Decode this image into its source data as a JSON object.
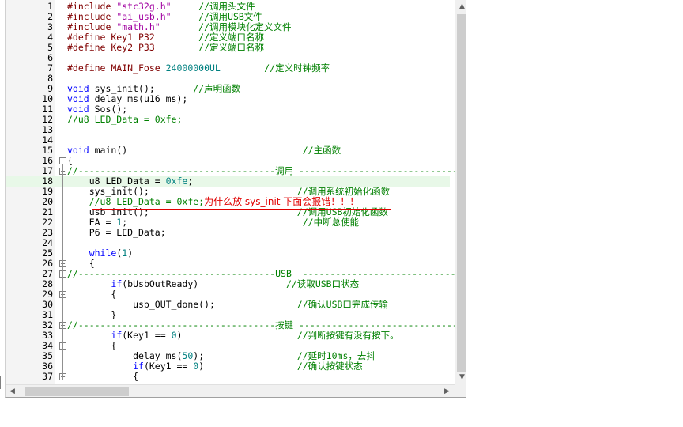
{
  "editor": {
    "lines": [
      {
        "n": "1",
        "fold": "",
        "segs": [
          {
            "t": "#include ",
            "c": "pp"
          },
          {
            "t": "\"stc32g.h\"",
            "c": "str"
          },
          {
            "t": "     ",
            "c": ""
          },
          {
            "t": "//调用头文件",
            "c": "cm"
          }
        ]
      },
      {
        "n": "2",
        "fold": "",
        "segs": [
          {
            "t": "#include ",
            "c": "pp"
          },
          {
            "t": "\"ai_usb.h\"",
            "c": "str"
          },
          {
            "t": "     ",
            "c": ""
          },
          {
            "t": "//调用USB文件",
            "c": "cm"
          }
        ]
      },
      {
        "n": "3",
        "fold": "",
        "segs": [
          {
            "t": "#include ",
            "c": "pp"
          },
          {
            "t": "\"math.h\"",
            "c": "str"
          },
          {
            "t": "       ",
            "c": ""
          },
          {
            "t": "//调用模块化定义文件",
            "c": "cm"
          }
        ]
      },
      {
        "n": "4",
        "fold": "",
        "segs": [
          {
            "t": "#define Key1 P32        ",
            "c": "pp"
          },
          {
            "t": "//定义端口名称",
            "c": "cm"
          }
        ]
      },
      {
        "n": "5",
        "fold": "",
        "segs": [
          {
            "t": "#define Key2 P33        ",
            "c": "pp"
          },
          {
            "t": "//定义端口名称",
            "c": "cm"
          }
        ]
      },
      {
        "n": "6",
        "fold": "",
        "segs": []
      },
      {
        "n": "7",
        "fold": "",
        "segs": [
          {
            "t": "#define MAIN_Fose ",
            "c": "pp"
          },
          {
            "t": "24000000UL",
            "c": "num"
          },
          {
            "t": "        ",
            "c": ""
          },
          {
            "t": "//定义时钟频率",
            "c": "cm"
          }
        ]
      },
      {
        "n": "8",
        "fold": "",
        "segs": []
      },
      {
        "n": "9",
        "fold": "",
        "segs": [
          {
            "t": "void",
            "c": "kw"
          },
          {
            "t": " sys_init();       ",
            "c": ""
          },
          {
            "t": "//声明函数",
            "c": "cm"
          }
        ]
      },
      {
        "n": "10",
        "fold": "",
        "segs": [
          {
            "t": "void",
            "c": "kw"
          },
          {
            "t": " delay_ms(u16 ms);",
            "c": ""
          }
        ]
      },
      {
        "n": "11",
        "fold": "",
        "segs": [
          {
            "t": "void",
            "c": "kw"
          },
          {
            "t": " Sos();",
            "c": ""
          }
        ]
      },
      {
        "n": "12",
        "fold": "",
        "segs": [
          {
            "t": "//u8 LED_Data = 0xfe;",
            "c": "cm"
          }
        ]
      },
      {
        "n": "13",
        "fold": "",
        "segs": []
      },
      {
        "n": "14",
        "fold": "",
        "segs": []
      },
      {
        "n": "15",
        "fold": "",
        "segs": [
          {
            "t": "void",
            "c": "kw"
          },
          {
            "t": " main()                                ",
            "c": ""
          },
          {
            "t": "//主函数",
            "c": "cm"
          }
        ]
      },
      {
        "n": "16",
        "fold": "−",
        "segs": [
          {
            "t": "{",
            "c": ""
          }
        ]
      },
      {
        "n": "17",
        "fold": "−",
        "segs": [
          {
            "t": "//------------------------------------调用 --------------------------------------",
            "c": "cm"
          }
        ]
      },
      {
        "n": "18",
        "fold": "",
        "hl": true,
        "segs": [
          {
            "t": "    u8 LED_Data = ",
            "c": ""
          },
          {
            "t": "0xfe",
            "c": "num"
          },
          {
            "t": ";",
            "c": ""
          }
        ]
      },
      {
        "n": "19",
        "fold": "",
        "segs": [
          {
            "t": "    sys_init();                           ",
            "c": ""
          },
          {
            "t": "//调用系统初始化函数",
            "c": "cm"
          }
        ]
      },
      {
        "n": "20",
        "fold": "",
        "segs": [
          {
            "t": "    //u8 LED_Data = 0xfe;",
            "c": "cm"
          },
          {
            "t": "为什么放 sys_init 下面会报错！！！",
            "c": "red"
          }
        ]
      },
      {
        "n": "21",
        "fold": "",
        "segs": [
          {
            "t": "    usb_init();                           ",
            "c": ""
          },
          {
            "t": "//调用USB初始化函数",
            "c": "cm"
          }
        ]
      },
      {
        "n": "22",
        "fold": "",
        "segs": [
          {
            "t": "    EA = ",
            "c": ""
          },
          {
            "t": "1",
            "c": "num"
          },
          {
            "t": ";                                ",
            "c": ""
          },
          {
            "t": "//中断总使能",
            "c": "cm"
          }
        ]
      },
      {
        "n": "23",
        "fold": "",
        "segs": [
          {
            "t": "    P6 = LED_Data;",
            "c": ""
          }
        ]
      },
      {
        "n": "24",
        "fold": "",
        "segs": []
      },
      {
        "n": "25",
        "fold": "",
        "segs": [
          {
            "t": "    ",
            "c": ""
          },
          {
            "t": "while",
            "c": "kw"
          },
          {
            "t": "(",
            "c": ""
          },
          {
            "t": "1",
            "c": "num"
          },
          {
            "t": ")",
            "c": ""
          }
        ]
      },
      {
        "n": "26",
        "fold": "−",
        "segs": [
          {
            "t": "    {",
            "c": ""
          }
        ]
      },
      {
        "n": "27",
        "fold": "−",
        "segs": [
          {
            "t": "//------------------------------------USB  --------------------------------------",
            "c": "cm"
          }
        ]
      },
      {
        "n": "28",
        "fold": "",
        "segs": [
          {
            "t": "        ",
            "c": ""
          },
          {
            "t": "if",
            "c": "kw"
          },
          {
            "t": "(bUsbOutReady)                ",
            "c": ""
          },
          {
            "t": "//读取USB口状态",
            "c": "cm"
          }
        ]
      },
      {
        "n": "29",
        "fold": "−",
        "segs": [
          {
            "t": "        {",
            "c": ""
          }
        ]
      },
      {
        "n": "30",
        "fold": "",
        "segs": [
          {
            "t": "            usb_OUT_done();               ",
            "c": ""
          },
          {
            "t": "//确认USB口完成传输",
            "c": "cm"
          }
        ]
      },
      {
        "n": "31",
        "fold": "",
        "segs": [
          {
            "t": "        }",
            "c": ""
          }
        ]
      },
      {
        "n": "32",
        "fold": "−",
        "segs": [
          {
            "t": "//------------------------------------按键 --------------------------------------",
            "c": "cm"
          }
        ]
      },
      {
        "n": "33",
        "fold": "",
        "segs": [
          {
            "t": "        ",
            "c": ""
          },
          {
            "t": "if",
            "c": "kw"
          },
          {
            "t": "(Key1 == ",
            "c": ""
          },
          {
            "t": "0",
            "c": "num"
          },
          {
            "t": ")                     ",
            "c": ""
          },
          {
            "t": "//判断按键有没有按下。",
            "c": "cm"
          }
        ]
      },
      {
        "n": "34",
        "fold": "−",
        "segs": [
          {
            "t": "        {",
            "c": ""
          }
        ]
      },
      {
        "n": "35",
        "fold": "",
        "segs": [
          {
            "t": "            delay_ms(",
            "c": ""
          },
          {
            "t": "50",
            "c": "num"
          },
          {
            "t": ");                 ",
            "c": ""
          },
          {
            "t": "//延时10ms，去抖",
            "c": "cm"
          }
        ]
      },
      {
        "n": "36",
        "fold": "",
        "segs": [
          {
            "t": "            ",
            "c": ""
          },
          {
            "t": "if",
            "c": "kw"
          },
          {
            "t": "(Key1 == ",
            "c": ""
          },
          {
            "t": "0",
            "c": "num"
          },
          {
            "t": ")                 ",
            "c": ""
          },
          {
            "t": "//确认按键状态",
            "c": "cm"
          }
        ]
      },
      {
        "n": "37",
        "fold": "−",
        "segs": [
          {
            "t": "            {",
            "c": ""
          }
        ]
      }
    ]
  },
  "scrollbars": {
    "up_icon": "arrow-up-icon",
    "down_icon": "arrow-down-icon",
    "left_icon": "arrow-left-icon",
    "right_icon": "arrow-right-icon"
  },
  "colors": {
    "keyword": "#0000ff",
    "comment": "#008000",
    "string": "#a000a0",
    "number": "#008080",
    "preprocessor": "#800000",
    "annotation": "#e00000",
    "highlight_line": "#e8f8e8"
  }
}
